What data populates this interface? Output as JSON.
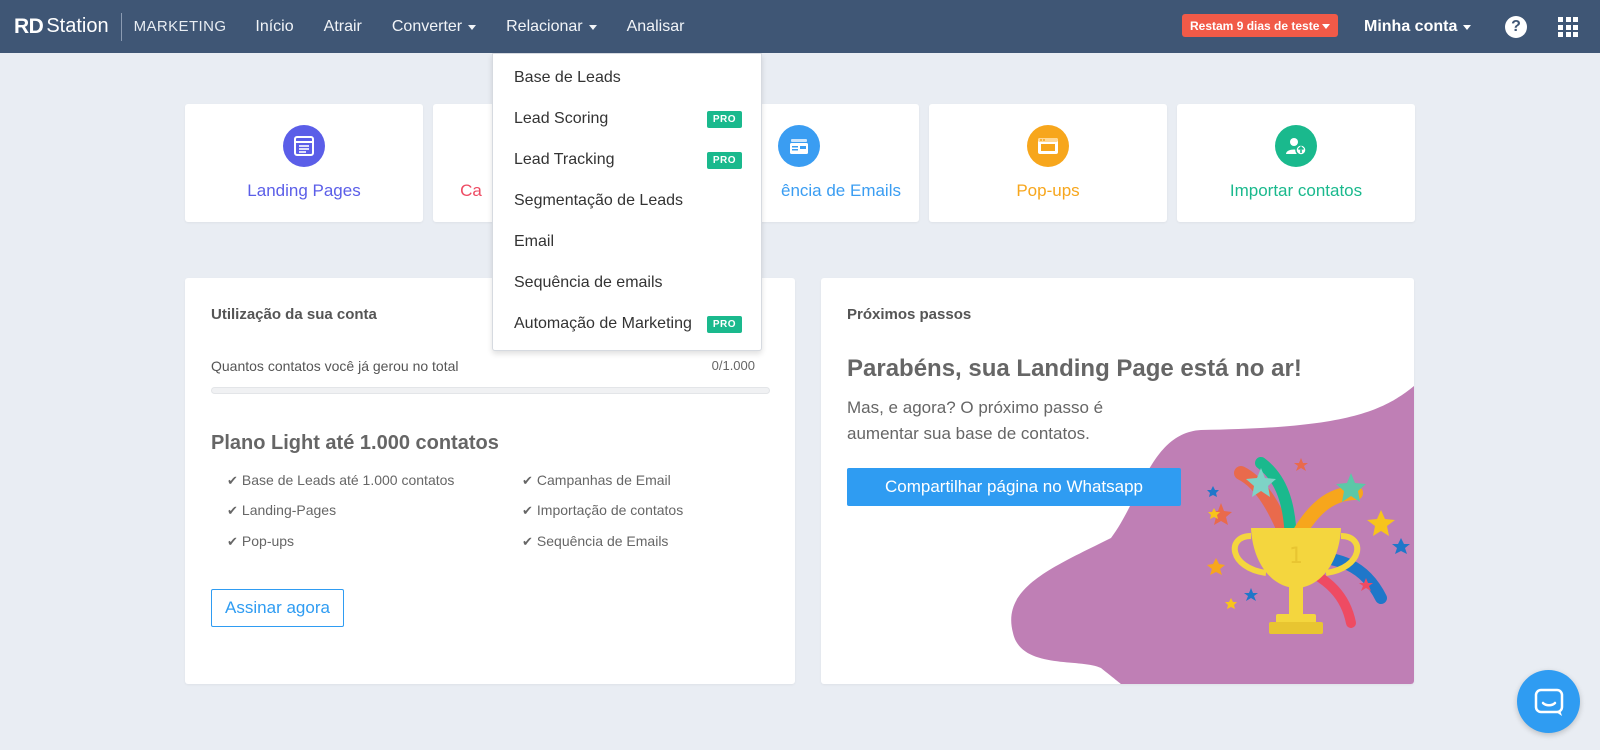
{
  "brand": {
    "name_bold": "RD",
    "name_rest": "Station",
    "product": "MARKETING"
  },
  "nav": {
    "items": [
      {
        "label": "Início",
        "dropdown": false
      },
      {
        "label": "Atrair",
        "dropdown": false
      },
      {
        "label": "Converter",
        "dropdown": true
      },
      {
        "label": "Relacionar",
        "dropdown": true
      },
      {
        "label": "Analisar",
        "dropdown": false
      }
    ],
    "trial_badge": "Restam 9 dias de teste",
    "account": "Minha conta",
    "help": "?"
  },
  "dropdown": {
    "items": [
      {
        "label": "Base de Leads",
        "badge": ""
      },
      {
        "label": "Lead Scoring",
        "badge": "PRO"
      },
      {
        "label": "Lead Tracking",
        "badge": "PRO"
      },
      {
        "label": "Segmentação de Leads",
        "badge": ""
      },
      {
        "label": "Email",
        "badge": ""
      },
      {
        "label": "Sequência de emails",
        "badge": ""
      },
      {
        "label": "Automação de Marketing",
        "badge": "PRO"
      }
    ]
  },
  "cards": [
    {
      "label": "Landing Pages",
      "color": "#5b5ee8",
      "icon": "landing-page-icon"
    },
    {
      "label": "Ca",
      "color": "#ee4b63",
      "icon": "campaign-icon"
    },
    {
      "label": "ência de Emails",
      "color": "#3a9df2",
      "icon": "email-sequence-icon"
    },
    {
      "label": "Pop-ups",
      "color": "#f7a61c",
      "icon": "popup-icon"
    },
    {
      "label": "Importar contatos",
      "color": "#1ab98d",
      "icon": "import-contacts-icon"
    }
  ],
  "account_usage": {
    "title": "Utilização da sua conta",
    "contacts_label": "Quantos contatos você já gerou no total",
    "contacts_value": "0/1.000",
    "progress": 0,
    "plan_title": "Plano Light até 1.000 contatos",
    "features_left": [
      "Base de Leads até 1.000 contatos",
      "Landing-Pages",
      "Pop-ups"
    ],
    "features_right": [
      "Campanhas de Email",
      "Importação de contatos",
      "Sequência de Emails"
    ],
    "subscribe_button": "Assinar agora"
  },
  "next_steps": {
    "title": "Próximos passos",
    "headline": "Parabéns, sua Landing Page está no ar!",
    "description": "Mas, e agora? O próximo passo é aumentar sua base de contatos.",
    "button": "Compartilhar página no Whatsapp"
  },
  "colors": {
    "topbar": "#3f5675",
    "accent": "#2f9cf2",
    "pro_badge": "#1ab98d",
    "trial_badge": "#f15a48",
    "blob": "#bf7fb5"
  }
}
